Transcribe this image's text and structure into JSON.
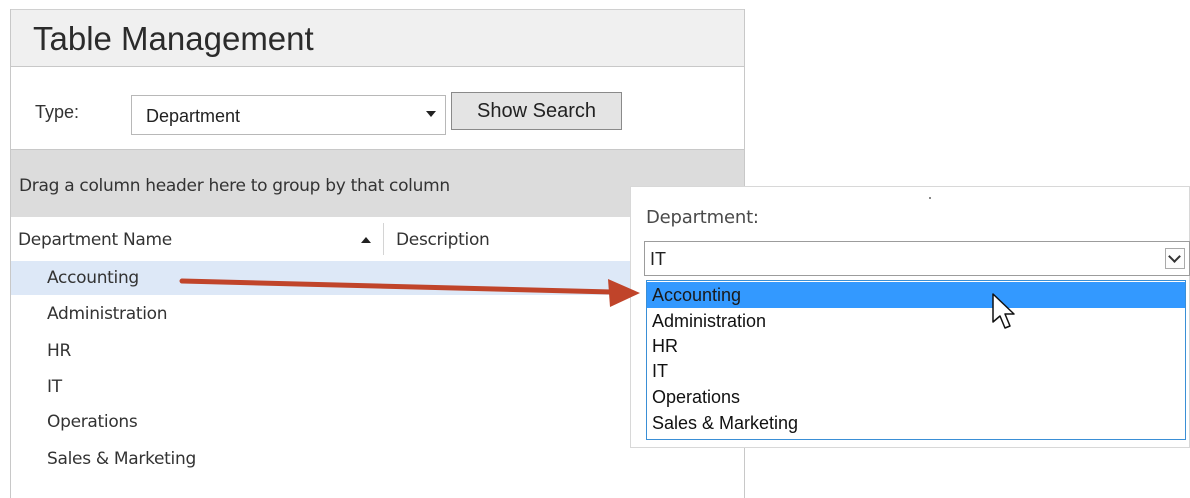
{
  "panel": {
    "title": "Table Management",
    "type_label": "Type:",
    "type_value": "Department",
    "show_search_label": "Show Search",
    "group_hint": "Drag a column header here to group by that column",
    "columns": [
      "Department Name",
      "Description"
    ],
    "rows": [
      "Accounting",
      "Administration",
      "HR",
      "IT",
      "Operations",
      "Sales & Marketing"
    ],
    "selected_row": "Accounting"
  },
  "popup": {
    "label": "Department:",
    "select_value": "IT",
    "options": [
      "Accounting",
      "Administration",
      "HR",
      "IT",
      "Operations",
      "Sales & Marketing"
    ],
    "highlighted_option": "Accounting"
  },
  "annotation": {
    "arrow_color": "#c0442a",
    "highlight_color": "#3399ff",
    "selected_row_color": "#dde8f7"
  },
  "icons": {
    "type_dropdown": "triangle-down-icon",
    "sort": "sort-ascending-icon",
    "popup_dropdown": "chevron-down-icon",
    "cursor": "mouse-pointer-icon"
  }
}
